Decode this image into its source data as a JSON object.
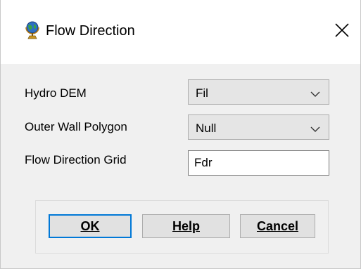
{
  "window": {
    "title": "Flow Direction",
    "app_icon": "globe-on-stand-icon",
    "close_icon": "close-icon"
  },
  "form": {
    "hydro_dem": {
      "label": "Hydro DEM",
      "value": "Fil"
    },
    "outer_wall_polygon": {
      "label": "Outer Wall Polygon",
      "value": "Null"
    },
    "flow_direction_grid": {
      "label": "Flow Direction Grid",
      "value": "Fdr"
    }
  },
  "buttons": {
    "ok": "OK",
    "help": "Help",
    "cancel": "Cancel"
  },
  "colors": {
    "default_button_border": "#0078d7",
    "title_bar": "#ffffff",
    "dialog_background": "#f0f0f0"
  }
}
